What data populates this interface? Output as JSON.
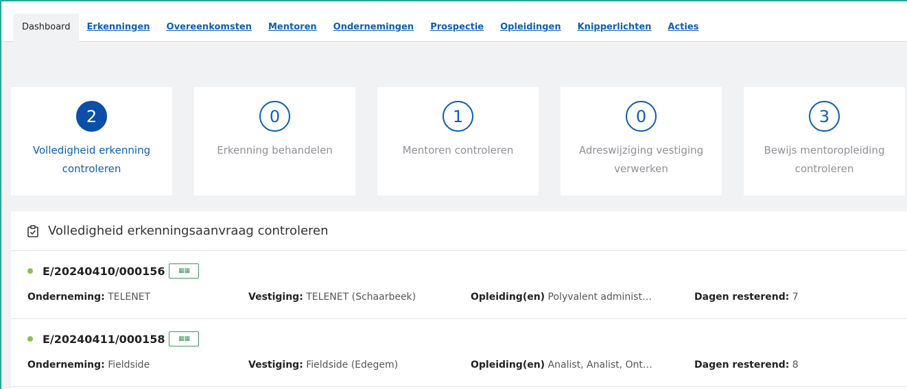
{
  "tabs": [
    {
      "label": "Dashboard",
      "active": true
    },
    {
      "label": "Erkenningen"
    },
    {
      "label": "Overeenkomsten"
    },
    {
      "label": "Mentoren"
    },
    {
      "label": "Ondernemingen"
    },
    {
      "label": "Prospectie"
    },
    {
      "label": "Opleidingen"
    },
    {
      "label": "Knipperlichten"
    },
    {
      "label": "Acties"
    }
  ],
  "cards": [
    {
      "count": "2",
      "label": "Volledigheid erkenning controleren",
      "selected": true
    },
    {
      "count": "0",
      "label": "Erkenning behandelen"
    },
    {
      "count": "1",
      "label": "Mentoren controleren"
    },
    {
      "count": "0",
      "label": "Adreswijziging vestiging verwerken"
    },
    {
      "count": "3",
      "label": "Bewijs mentoropleiding controleren"
    }
  ],
  "panel": {
    "title": "Volledigheid erkenningsaanvraag controleren",
    "icon": "clipboard-check-icon"
  },
  "labels": {
    "onderneming": "Onderneming:",
    "vestiging": "Vestiging:",
    "opleidingen": "Opleiding(en)",
    "dagen": "Dagen resterend:"
  },
  "rows": [
    {
      "id": "E/20240410/000156",
      "onderneming": "TELENET",
      "vestiging": "TELENET (Schaarbeek)",
      "opleidingen": "Polyvalent administ…",
      "dagen": "7"
    },
    {
      "id": "E/20240411/000158",
      "onderneming": "Fieldside",
      "vestiging": "Fieldside (Edegem)",
      "opleidingen": "Analist, Analist, Ont…",
      "dagen": "8"
    }
  ],
  "colors": {
    "accent": "#0b5fb5",
    "status_dot": "#8cc04f",
    "badge": "#3a9a5b",
    "frame": "#26a69a"
  }
}
